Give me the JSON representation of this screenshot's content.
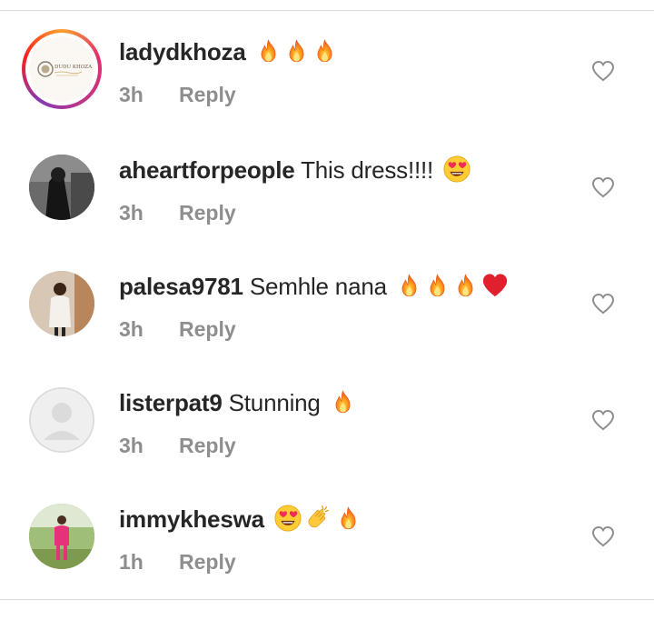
{
  "comments": [
    {
      "username": "ladydkhoza",
      "text": "",
      "time": "3h",
      "reply_label": "Reply",
      "avatar_caption": "DUDU KHOZA"
    },
    {
      "username": "aheartforpeople",
      "text": "This dress!!!!",
      "time": "3h",
      "reply_label": "Reply"
    },
    {
      "username": "palesa9781",
      "text": "Semhle nana",
      "time": "3h",
      "reply_label": "Reply"
    },
    {
      "username": "listerpat9",
      "text": "Stunning",
      "time": "3h",
      "reply_label": "Reply"
    },
    {
      "username": "immykheswa",
      "text": "",
      "time": "1h",
      "reply_label": "Reply"
    }
  ],
  "emoji_sequences": [
    [
      "fire",
      "fire",
      "fire"
    ],
    [
      "heart-eyes"
    ],
    [
      "fire",
      "fire",
      "fire",
      "red-heart"
    ],
    [
      "fire"
    ],
    [
      "heart-eyes",
      "clapping-hands",
      "fire"
    ]
  ],
  "colors": {
    "username": "#262626",
    "meta": "#8e8e8e",
    "divider": "#dbdbdb"
  }
}
